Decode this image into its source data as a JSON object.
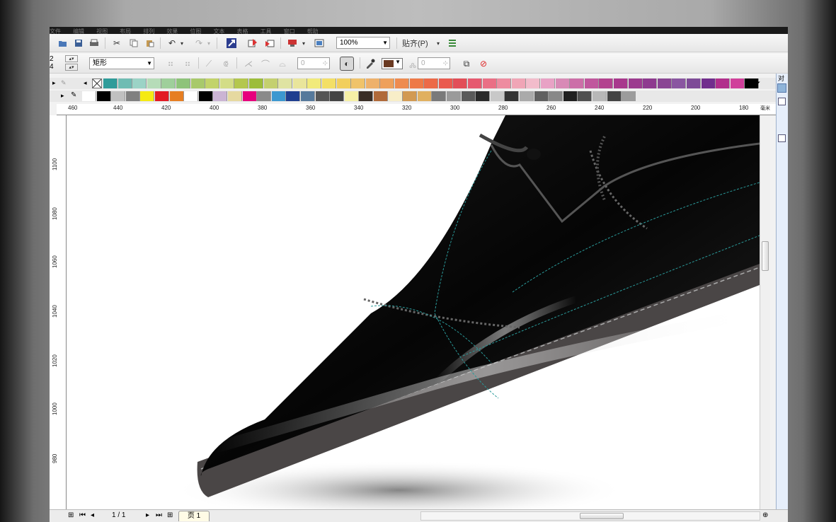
{
  "menu": {
    "items": [
      "文件",
      "编辑",
      "视图",
      "布局",
      "排列",
      "效果",
      "位图",
      "文本",
      "表格",
      "工具",
      "窗口",
      "帮助"
    ]
  },
  "toolbar": {
    "zoom_value": "100%",
    "snap_label": "贴齐(P)"
  },
  "property_bar": {
    "stepper_top": "2",
    "stepper_bottom": "4",
    "shape_type": "矩形",
    "angle_value": "0",
    "outline_value": "0",
    "fill_color": "#6a3a22"
  },
  "palette": {
    "row1": [
      "#2f9c9a",
      "#6fbcb3",
      "#9bd3c6",
      "#b6dcb8",
      "#9fcf9b",
      "#8ec37a",
      "#a8c96b",
      "#c2d36a",
      "#d3dd87",
      "#b4c74e",
      "#9dbd3a",
      "#c4d06f",
      "#dfe3a2",
      "#e9e59b",
      "#f1ea7b",
      "#f3df66",
      "#f2cf5d",
      "#f0c36a",
      "#eeb16b",
      "#eea05b",
      "#ee8b4f",
      "#ee7a47",
      "#ec6a48",
      "#ea5a4e",
      "#e24e58",
      "#e6596f",
      "#ea6f85",
      "#ee8ca0",
      "#f0a5b6",
      "#f2bccb",
      "#e8a2c5",
      "#d88ab6",
      "#cc6fa8",
      "#c0579d",
      "#b3428f",
      "#a8388d",
      "#9c3b8f",
      "#8e3a8f",
      "#8a4593",
      "#8a56a1",
      "#7e4b97",
      "#712e8d",
      "#b12f8c",
      "#d0409b",
      "#000000"
    ],
    "row2": [
      "#ffffff",
      "#000000",
      "#c0c0c0",
      "#808080",
      "#f5ea14",
      "#e21b23",
      "#e67e22",
      "#ffffff",
      "#000000",
      "#cbb4d4",
      "#e6d9a0",
      "#e7007d",
      "#8a8a8a",
      "#3c98d0",
      "#1f3e8f",
      "#56799b",
      "#555555",
      "#444444",
      "#f6f0a6",
      "#3a2e26",
      "#b06a3a",
      "#f8eec8",
      "#d29a52",
      "#e0b060",
      "#7a7a7a",
      "#9a9a9a",
      "#5a5a5a",
      "#2a2a2a",
      "#c8c8c8",
      "#333333",
      "#aaaaaa",
      "#606060",
      "#888888",
      "#202020",
      "#505050",
      "#b8b8b8",
      "#444444",
      "#9c9c9c"
    ]
  },
  "ruler": {
    "horizontal": [
      "460",
      "440",
      "420",
      "400",
      "380",
      "360",
      "340",
      "320",
      "300",
      "280",
      "260",
      "240",
      "220",
      "200",
      "180",
      "毫米"
    ],
    "vertical": [
      "1100",
      "1080",
      "1060",
      "1040",
      "1020",
      "1000",
      "980"
    ]
  },
  "status": {
    "page_count": "1 / 1",
    "page_tab": "页 1"
  }
}
